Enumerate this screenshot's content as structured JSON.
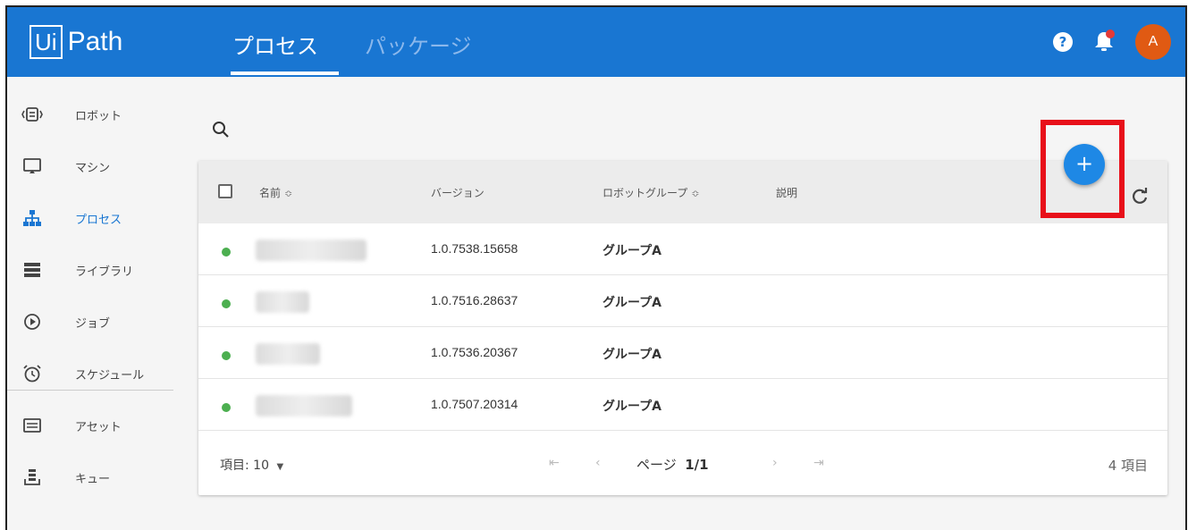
{
  "header": {
    "logo_ui": "Ui",
    "logo_path": "Path",
    "tabs": [
      {
        "label": "プロセス",
        "active": true
      },
      {
        "label": "パッケージ",
        "active": false
      }
    ],
    "help_icon": "?",
    "avatar_initial": "A",
    "accent_color": "#1976d2"
  },
  "sidebar": {
    "items": [
      {
        "label": "ロボット",
        "icon": "robot-icon"
      },
      {
        "label": "マシン",
        "icon": "monitor-icon"
      },
      {
        "label": "プロセス",
        "icon": "sitemap-icon",
        "active": true
      },
      {
        "label": "ライブラリ",
        "icon": "library-icon"
      },
      {
        "label": "ジョブ",
        "icon": "play-circle-icon"
      },
      {
        "label": "スケジュール",
        "icon": "alarm-clock-icon"
      },
      {
        "label": "アセット",
        "icon": "asset-icon"
      },
      {
        "label": "キュー",
        "icon": "queue-icon"
      }
    ]
  },
  "table": {
    "columns": {
      "name": "名前",
      "version": "バージョン",
      "robot_group": "ロボットグループ",
      "description": "説明"
    },
    "rows": [
      {
        "version": "1.0.7538.15658",
        "group": "グループA"
      },
      {
        "version": "1.0.7516.28637",
        "group": "グループA"
      },
      {
        "version": "1.0.7536.20367",
        "group": "グループA"
      },
      {
        "version": "1.0.7507.20314",
        "group": "グループA"
      }
    ],
    "footer": {
      "items_per_page_label": "項目: 10",
      "page_label": "ページ",
      "page_value": "1/1",
      "total": "4 項目"
    }
  },
  "fab": {
    "label": "+"
  }
}
